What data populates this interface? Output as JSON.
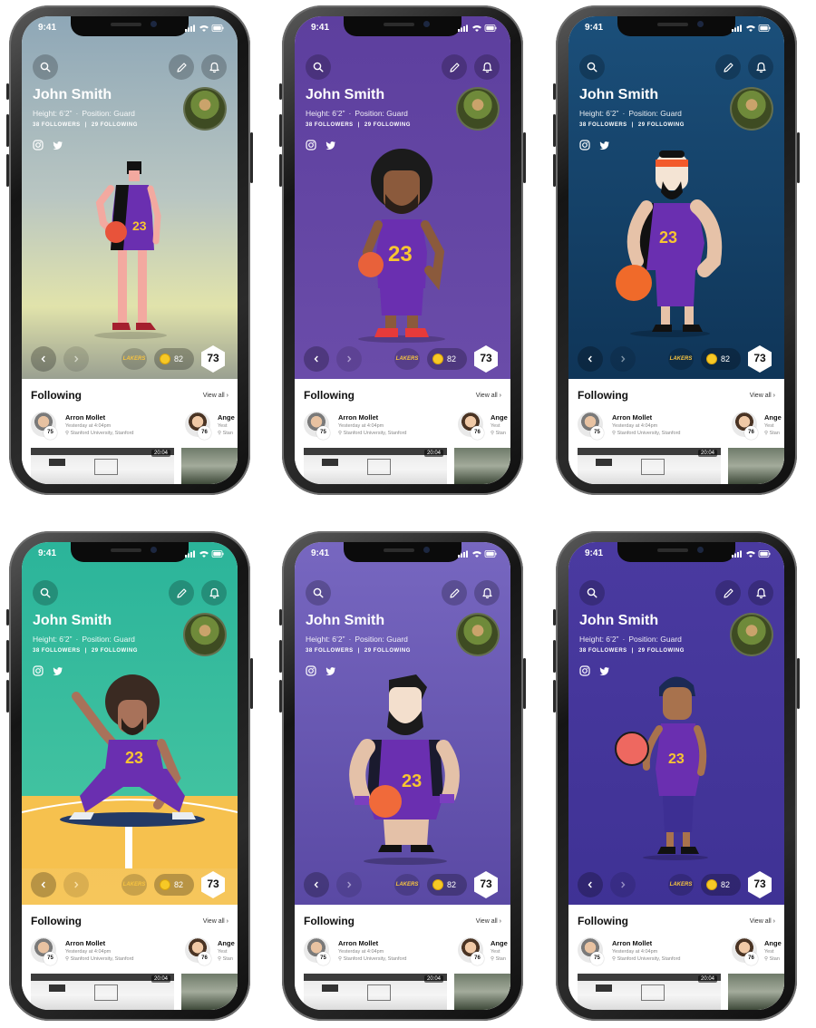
{
  "status": {
    "time": "9:41"
  },
  "profile": {
    "name": "John Smith",
    "height": "Height: 6’2”",
    "position": "Position: Guard",
    "followers": "38 FOLLOWERS",
    "following": "29 FOLLOWING",
    "social_icons": [
      "instagram-icon",
      "twitter-icon"
    ],
    "jersey_number": "23"
  },
  "header_icons": [
    "search-icon",
    "pencil-icon",
    "bell-icon"
  ],
  "bottom_bar": {
    "team_logo_text": "LAKERS",
    "coins": "82",
    "rating": "73"
  },
  "following_section": {
    "title": "Following",
    "view_all": "View all",
    "cards": [
      {
        "name": "Arron Mollet",
        "time": "Yesterday at 4:04pm",
        "location": "Stanford University, Stanford",
        "rating": "75"
      },
      {
        "name": "Ange",
        "time": "Yest",
        "location": "Stan",
        "rating": "76"
      }
    ],
    "video_duration": "20:04"
  },
  "variants": [
    {
      "theme": "gray-sky",
      "bg_top": "#8aa3b3",
      "bg_bottom": "#d7dfb0"
    },
    {
      "theme": "purple",
      "bg_top": "#5d3f9e",
      "bg_bottom": "#6a4ca9"
    },
    {
      "theme": "navy",
      "bg_top": "#1b4f7a",
      "bg_bottom": "#0f3558"
    },
    {
      "theme": "teal-court",
      "bg_top": "#2fb39a",
      "bg_bottom": "#f4c35a"
    },
    {
      "theme": "lavender",
      "bg_top": "#7767c0",
      "bg_bottom": "#5a49a4"
    },
    {
      "theme": "indigo",
      "bg_top": "#4a3aa0",
      "bg_bottom": "#3f3295"
    }
  ],
  "colors": {
    "accent_gold": "#f6c340",
    "jersey_purple": "#6a2fb0",
    "jersey_number": "#f7c531"
  }
}
